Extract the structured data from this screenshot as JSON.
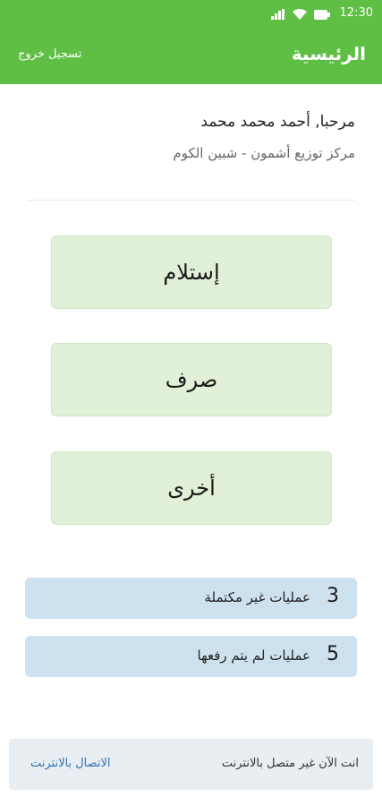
{
  "status_bar": {
    "time": "12:30",
    "icons": [
      "signal-icon",
      "wifi-icon",
      "battery-icon"
    ]
  },
  "header": {
    "title": "الرئيسية",
    "logout_label": "تسجيل خروج"
  },
  "user": {
    "greeting": "مرحبا, أحمد محمد محمد",
    "center": "مركز توزيع أشمون - شبين الكوم"
  },
  "actions": [
    {
      "label": "إستلام"
    },
    {
      "label": "صرف"
    },
    {
      "label": "أخرى"
    }
  ],
  "summary": [
    {
      "count": "3",
      "label": "عمليات غير مكتملة"
    },
    {
      "count": "5",
      "label": "عمليات لم يتم رفعها"
    }
  ],
  "offline": {
    "message": "انت الآن غير متصل بالانترنت",
    "connect_label": "الاتصال بالانترنت"
  },
  "colors": {
    "primary": "#5fbf45",
    "action_bg": "#e1f1d7",
    "info_bg": "#cde2ee",
    "link": "#2f73b5"
  }
}
